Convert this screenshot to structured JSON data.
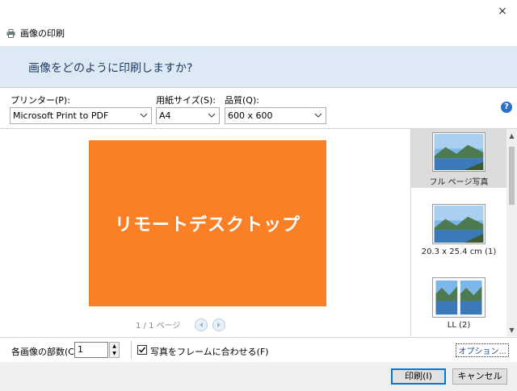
{
  "window": {
    "title": "画像の印刷",
    "close_glyph": "×",
    "printer_icon": "printer-icon"
  },
  "header": {
    "heading": "画像をどのように印刷しますか?"
  },
  "controls": {
    "printer_label": "プリンター(P):",
    "printer_value": "Microsoft Print to PDF",
    "paper_label": "用紙サイズ(S):",
    "paper_value": "A4",
    "quality_label": "品質(Q):",
    "quality_value": "600 x 600",
    "help_glyph": "?"
  },
  "preview": {
    "image_text": "リモートデスクトップ",
    "image_color": "#fb7f24",
    "page_indicator": "1 / 1 ページ"
  },
  "layouts": [
    {
      "caption": "フル ページ写真",
      "selected": true
    },
    {
      "caption": "20.3 x 25.4 cm (1)",
      "selected": false
    },
    {
      "caption": "LL (2)",
      "selected": false
    }
  ],
  "bottom": {
    "copies_label": "各画像の部数(C):",
    "copies_value": "1",
    "fit_label": "写真をフレームに合わせる(F)",
    "fit_checked": true,
    "options_link": "オプション..."
  },
  "footer": {
    "print_label": "印刷(I)",
    "cancel_label": "キャンセル"
  },
  "colors": {
    "header_band": "#dde9f5",
    "accent": "#0078d7"
  }
}
